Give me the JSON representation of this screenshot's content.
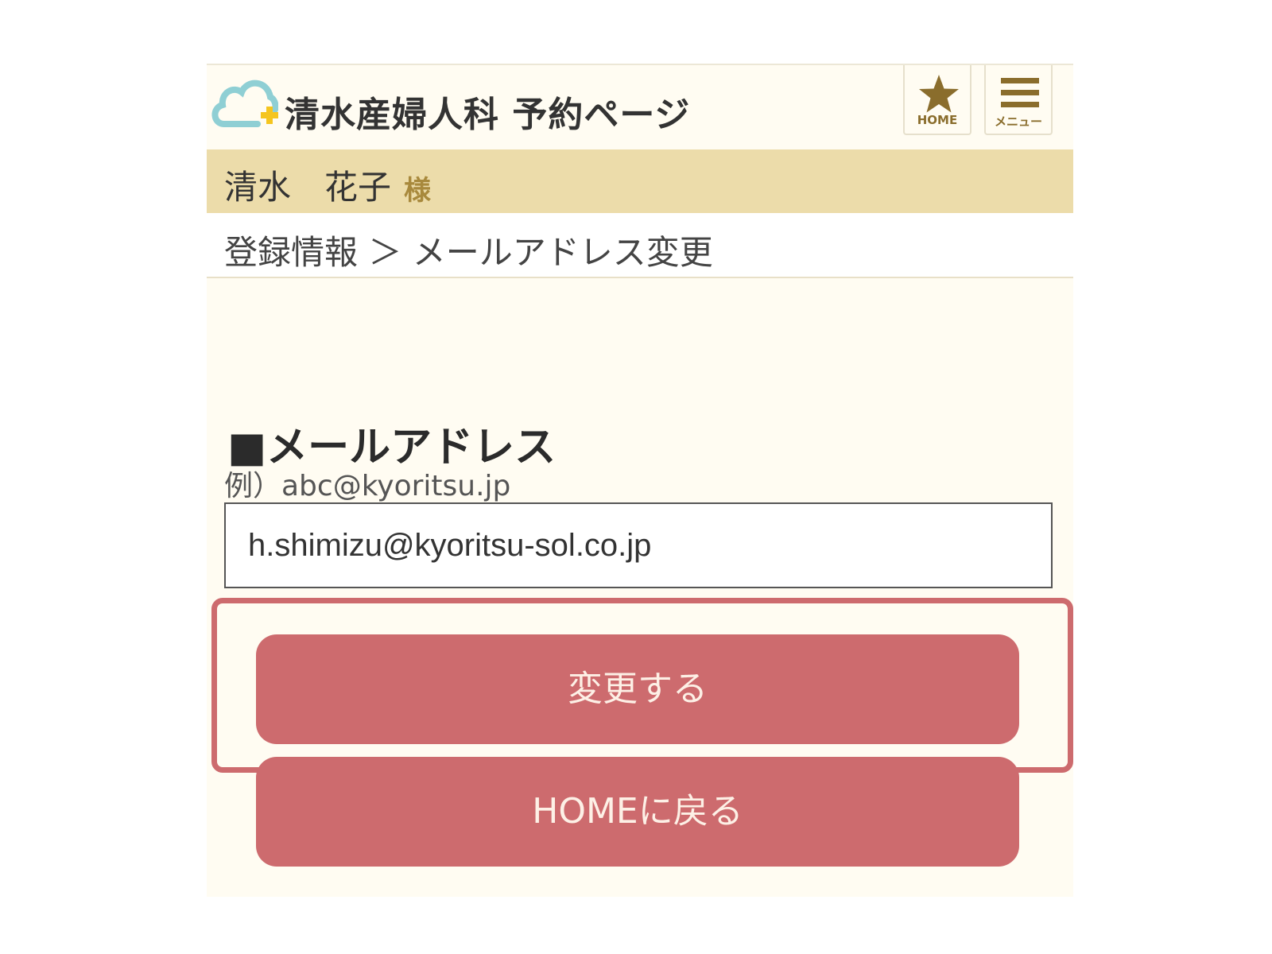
{
  "header": {
    "title": "清水産婦人科 予約ページ",
    "home_label": "HOME",
    "menu_label": "メニュー",
    "logo_icon": "cloud-cross-icon",
    "home_icon": "star-icon",
    "menu_icon": "hamburger-icon"
  },
  "user": {
    "name": "清水　花子",
    "suffix": "様"
  },
  "breadcrumb": {
    "text": "登録情報 ＞ メールアドレス変更"
  },
  "form": {
    "section_title": "■メールアドレス",
    "example": "例）abc@kyoritsu.jp",
    "email_value": "h.shimizu@kyoritsu-sol.co.jp"
  },
  "buttons": {
    "change": "変更する",
    "home": "HOMEに戻る"
  },
  "colors": {
    "background": "#fffcf2",
    "user_bar": "#ecdcaa",
    "accent": "#cd6b6e",
    "header_icon": "#8a6d2c",
    "logo_cloud": "#8fcfd4",
    "logo_cross": "#f5c51e"
  }
}
